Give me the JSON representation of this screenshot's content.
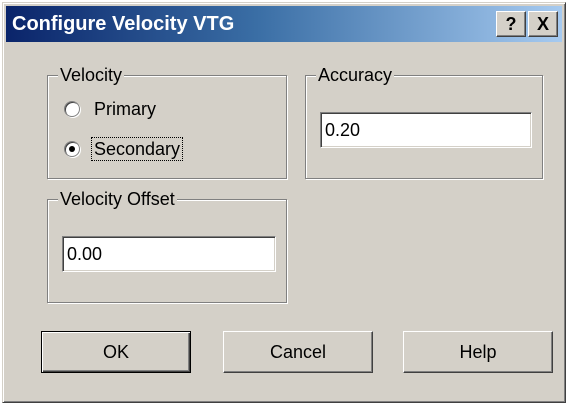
{
  "window": {
    "title": "Configure Velocity VTG",
    "help_button": "?",
    "close_button": "X"
  },
  "velocity": {
    "group_label": "Velocity",
    "options": [
      {
        "label": "Primary",
        "selected": false
      },
      {
        "label": "Secondary",
        "selected": true
      }
    ]
  },
  "accuracy": {
    "group_label": "Accuracy",
    "value": "0.20"
  },
  "velocity_offset": {
    "group_label": "Velocity Offset",
    "value": "0.00"
  },
  "buttons": {
    "ok": "OK",
    "cancel": "Cancel",
    "help": "Help"
  }
}
